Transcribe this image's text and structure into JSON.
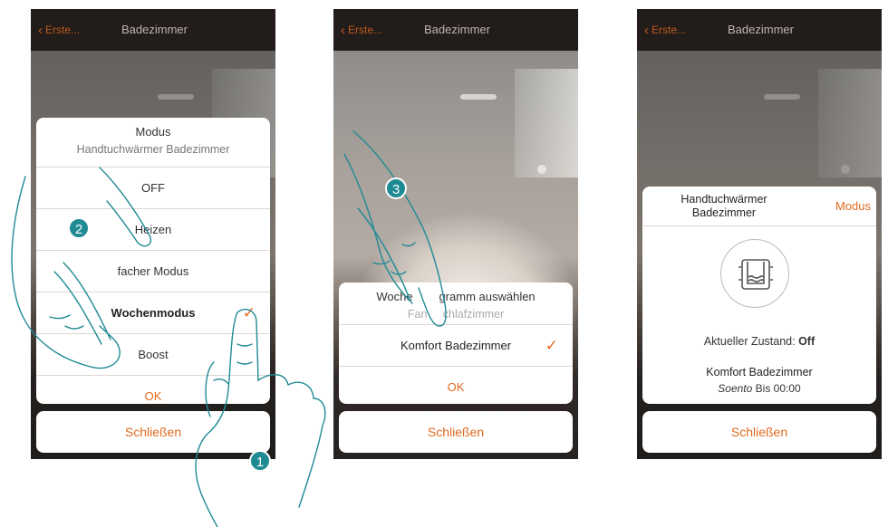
{
  "back_label": "Erste...",
  "room_title": "Badezimmer",
  "close_label": "Schließen",
  "accent": "#e06a1f",
  "step_color": "#1f8a94",
  "screen1": {
    "title": "Modus",
    "subtitle": "Handtuchwärmer Badezimmer",
    "options": [
      "OFF",
      "Heizen",
      "facher Modus",
      "Wochenmodus",
      "Boost"
    ],
    "selected_option": "Wochenmodus",
    "ok_label": "OK",
    "step": "2",
    "step_b": "1"
  },
  "screen2": {
    "title": "Woche        gramm auswählen",
    "subtitle": "Fan     chlafzimmer",
    "selected_program": "Komfort Badezimmer",
    "ok_label": "OK",
    "step": "3"
  },
  "screen3": {
    "device_name_line1": "Handtuchwärmer",
    "device_name_line2": "Badezimmer",
    "mode_link": "Modus",
    "icon": "towel-warmer-icon",
    "state_label": "Aktueller Zustand:",
    "state_value": "Off",
    "program_name": "Komfort Badezimmer",
    "until_prefix": "Soento",
    "until_text": "Bis 00:00"
  }
}
